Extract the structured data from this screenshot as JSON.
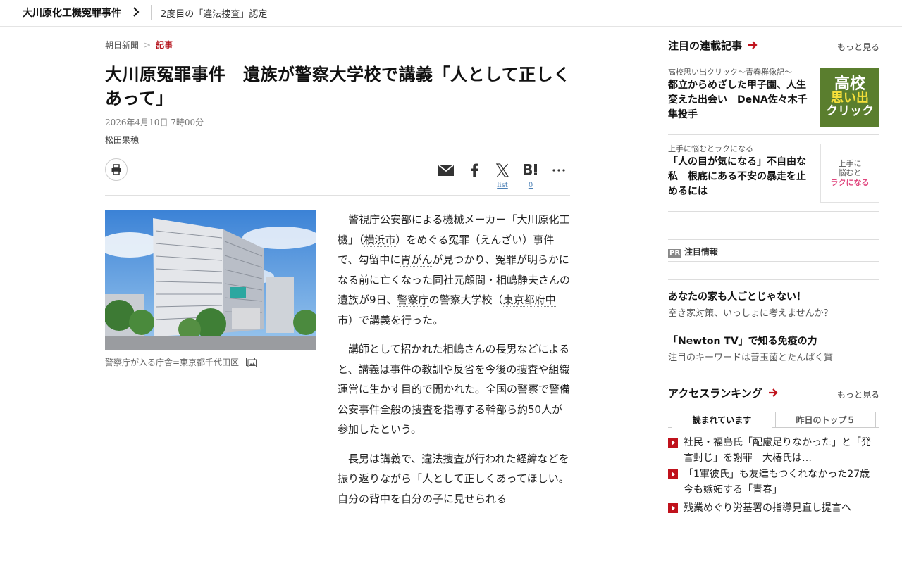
{
  "topbar": {
    "topic": "大川原化工機冤罪事件",
    "subtopic": "2度目の「違法捜査」認定"
  },
  "breadcrumb": {
    "home": "朝日新聞",
    "separator": ">",
    "current": "記事"
  },
  "article": {
    "headline": "大川原冤罪事件　遺族が警察大学校で講義「人として正しくあって」",
    "date": "2026年4月10日 7時00分",
    "author": "松田果穂",
    "photo_caption": "警察庁が入る庁舎=東京都千代田区",
    "share": {
      "x_label": "list",
      "hatena_count": "0"
    },
    "paragraphs": [
      {
        "segments": [
          {
            "text": "警視庁公安部による機械メーカー「大川原化工機」（"
          },
          {
            "text": "横浜市",
            "link": true
          },
          {
            "text": "）をめぐる冤罪（えんざい）事件で、勾留中に"
          },
          {
            "text": "胃がん",
            "link": true
          },
          {
            "text": "が見つかり、冤罪が明らかになる前に亡くなった同社元顧問・相嶋静夫さんの遺族が9日、"
          },
          {
            "text": "警察庁",
            "link": true
          },
          {
            "text": "の警察大学校（"
          },
          {
            "text": "東京都府中市",
            "link": true
          },
          {
            "text": "）で講義を行った。"
          }
        ]
      },
      {
        "segments": [
          {
            "text": "講師として招かれた相嶋さんの長男などによると、講義は事件の教訓や反省を今後の捜査や組織運営に生かす目的で開かれた。全国の警察で警備公安事件全般の捜査を指導する幹部ら約50人が参加したという。"
          }
        ]
      },
      {
        "segments": [
          {
            "text": "長男は講義で、違法捜査が行われた経緯などを振り返りながら「人として正しくあってほしい。自分の背中を自分の子に見せられる"
          }
        ]
      }
    ]
  },
  "rail": {
    "series": {
      "heading": "注目の連載記事",
      "more": "もっと見る",
      "items": [
        {
          "category": "高校思い出クリック～青春群像記～",
          "title": "都立からめざした甲子園、人生変えた出会い　DeNA佐々木千隼投手",
          "thumb_lines": [
            "高校",
            "思い出",
            "クリック"
          ]
        },
        {
          "category": "上手に悩むとラクになる",
          "title": "「人の目が気になる」不自由な私　根底にある不安の暴走を止めるには",
          "thumb_lines": [
            "上手に",
            "悩むと",
            "ラクになる"
          ]
        }
      ]
    },
    "pr": {
      "badge": "PR",
      "label": "注目情報",
      "items": [
        {
          "title": "あなたの家も人ごとじゃない！",
          "sub": "空き家対策、いっしょに考えませんか？"
        },
        {
          "title": "「Newton TV」で知る免疫の力",
          "sub": "注目のキーワードは善玉菌とたんぱく質"
        }
      ]
    },
    "ranking": {
      "heading": "アクセスランキング",
      "more": "もっと見る",
      "tabs": [
        "読まれています",
        "昨日のトップ５"
      ],
      "active_tab": 0,
      "items": [
        "社民・福島氏「配慮足りなかった」と「発言封じ」を謝罪　大椿氏は…",
        "「1軍彼氏」も友達もつくれなかった27歳　今も嫉妬する「青春」",
        "残業めぐり労基署の指導見直し提言へ"
      ]
    },
    "colors": {
      "accent_red": "#c0121c",
      "link_blue": "#4a7fb5"
    }
  }
}
